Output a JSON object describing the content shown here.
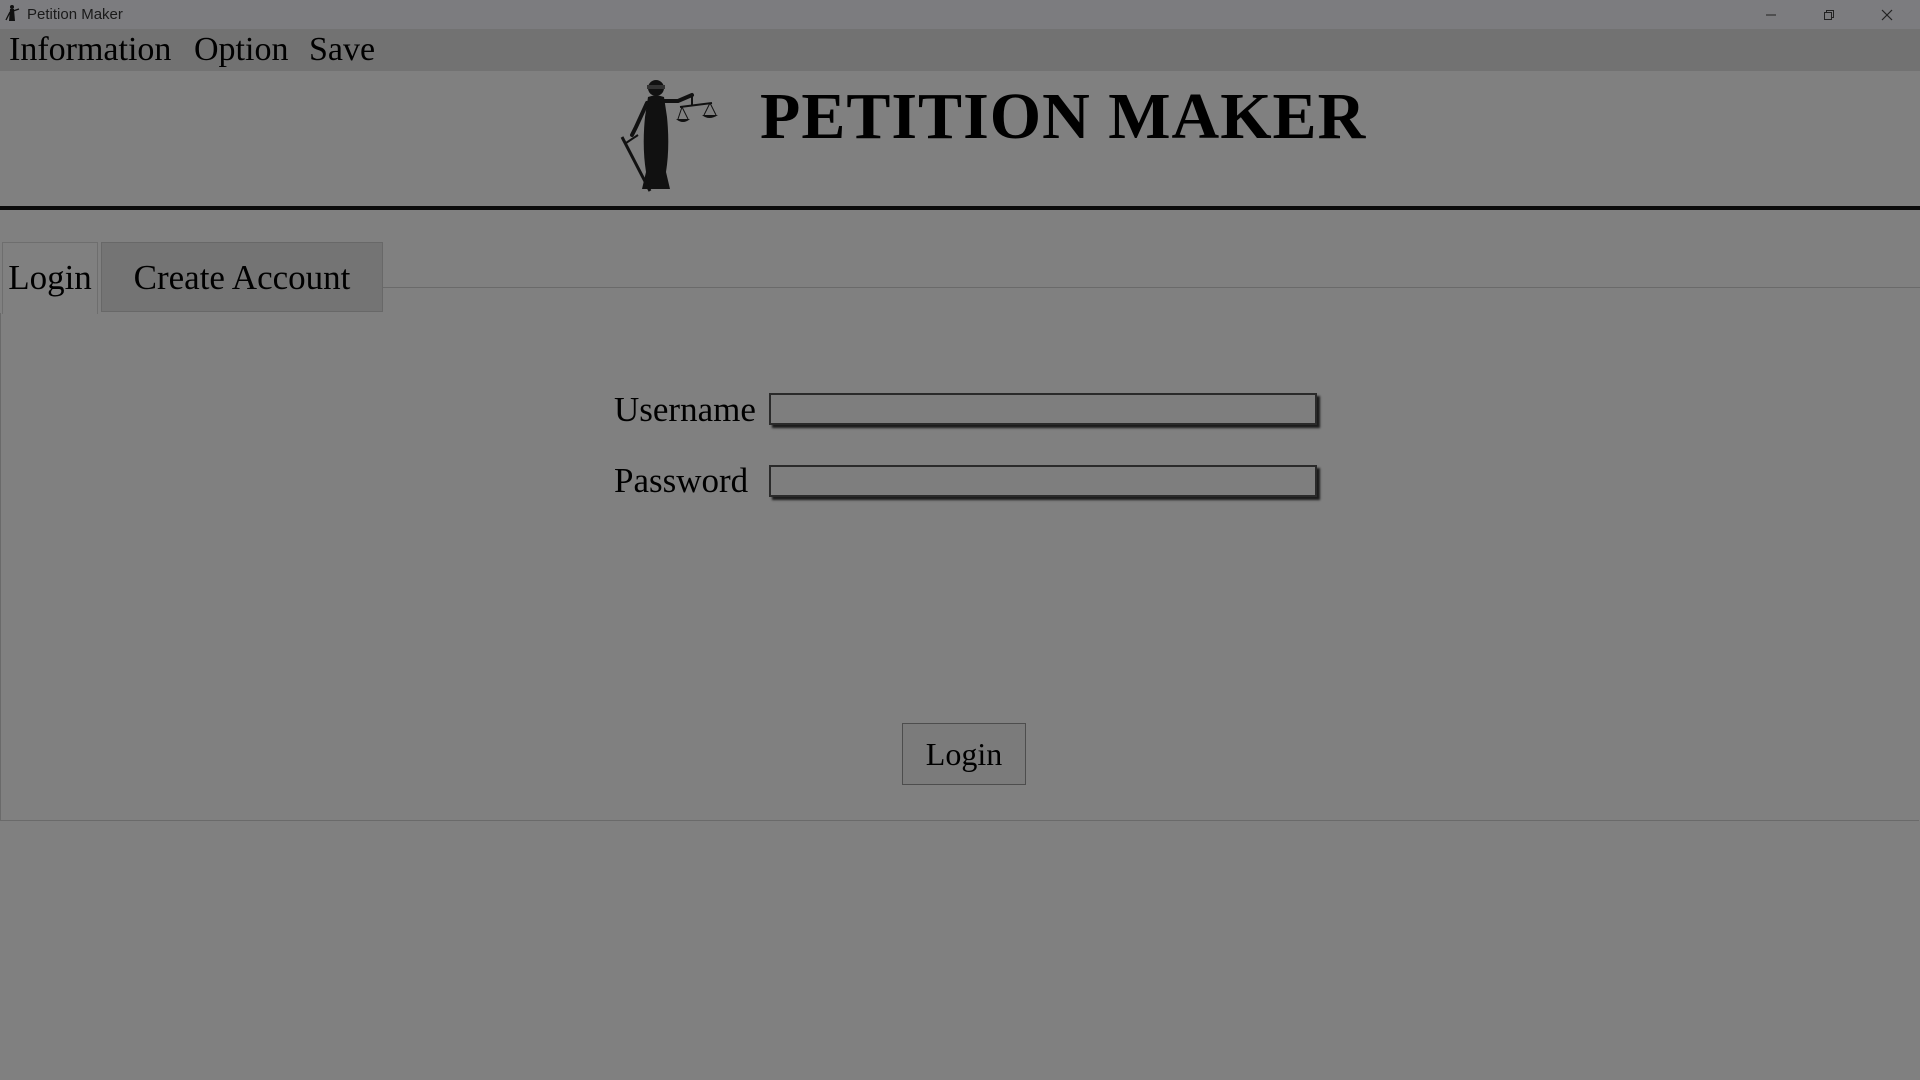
{
  "window": {
    "title": "Petition Maker",
    "icon": "justice-icon",
    "controls": [
      "minimize-icon",
      "restore-icon",
      "close-icon"
    ]
  },
  "menu": {
    "items": [
      "Information",
      "Option",
      "Save"
    ]
  },
  "header": {
    "title": "PETITION MAKER",
    "logo": "lady-justice-logo"
  },
  "tabs": [
    {
      "label": "Login",
      "selected": true
    },
    {
      "label": "Create Account",
      "selected": false
    }
  ],
  "form": {
    "username_label": "Username",
    "username_value": "",
    "password_label": "Password",
    "password_value": "",
    "login_label": "Login"
  },
  "colors": {
    "background": "#808080",
    "title_bar": "#7c7c7f",
    "menu_bar": "#727272",
    "divider": "#0b0b0b"
  }
}
